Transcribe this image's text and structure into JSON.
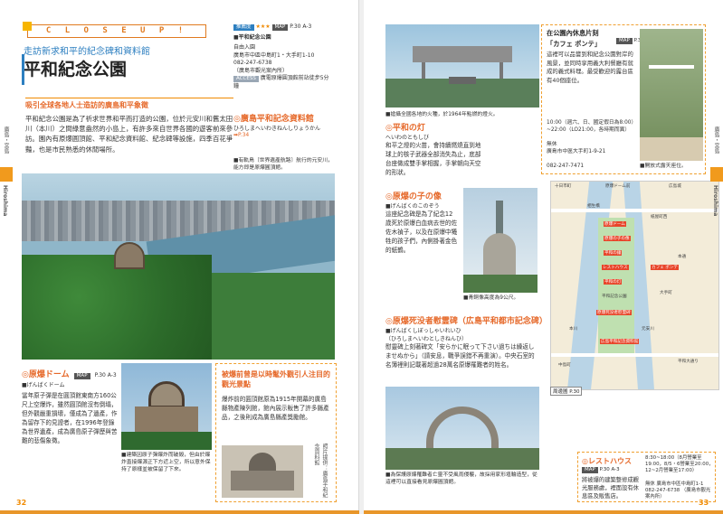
{
  "left": {
    "closeup": "C L O S E   U P !",
    "subtitle": "走訪新求和平的紀念碑和資料館",
    "title": "平和紀念公園",
    "info": {
      "rating_label": "推薦度",
      "stars": "★★★",
      "map_label": "MAP",
      "map_ref": "P.30 A-3",
      "name": "■平和紀念公園",
      "free": "自由入園",
      "address": "廣島市中區中島町1・大手町1-10",
      "tel": "082-247-6738",
      "tel_note": "（廣島市觀光案內所）",
      "access_label": "ACCESS",
      "access": "廣電原爆圓頂館前站徒步5分鐘"
    },
    "lead": "吸引全球各地人士造訪的廣島和平象徵",
    "intro": "平和紀念公園是為了祈求世界和平而打造的公園，位於元安川和舊太田川（本川）之間綠意盎然的小島上，有許多來自世界各國的遊客前來參訪。園內有原爆圓頂館、平和紀念資料館、紀念碑等設施，四季百花爭豔，也是市民熟悉的休閒場所。",
    "museum": {
      "title": "◎廣島平和記念資料館",
      "ruby": "ひろしまへいわきねんしりょうかん",
      "map": "➡P.34"
    },
    "photo_note": "■有軌鳥〔世界遺產航路〕航行的元安川，能方即是原爆圓頂館。",
    "dome": {
      "title": "◎原爆ドーム",
      "ruby": "■げんばくドーム",
      "map_label": "MAP",
      "map_ref": "P.30 A-3",
      "body": "當年原子彈是在圓頂館東南方160公尺上空爆炸，雖然圓頂館沒有倒塌，但外觀嚴重損壞，僅成為了遺產，作為留存下的見證者，在1996年登錄為世界遺產，成為廣島原子彈歷與苦難的悲傷象徵。",
      "caption": "■建築因原子彈爆炸而破毀，但由於爆炸直接爆源正下方近上空，所以意外保持了原樣並被保留了下來。"
    },
    "column": {
      "title": "被爆前曾是以時髦外觀引人注目的觀光景點",
      "body": "爆炸前的圓頂館原為1915年開幕的廣島縣物產陳列館，館內展示販售了許多縣產品，之後則成為廣島縣產獎勵館。",
      "vertical": "照片提供：廣島平和紀念資料館"
    },
    "page": "32",
    "side": "廣島・宮島",
    "side_en": "Hiroshima"
  },
  "right": {
    "photo1_cap": "■搶攝全國各地的火種，於1964年點燃的燈火。",
    "flame": {
      "title": "◎平和の灯",
      "ruby": "へいわのともしび",
      "body": "和平之燈的火苗，會持續燃燒直到地球上的核子武器全部消失為止，底部台座做成雙手掌相握，手掌朝向天空的形狀。"
    },
    "statue": {
      "title": "◎原爆の子の像",
      "ruby": "■げんばくのこのぞう",
      "body": "這座紀念碑是為了紀念12歲死於原爆白血病去世的佐佐木禎子，以及在原爆中犧牲的孩子們，內側掛著金色的紙鶴。",
      "caption": "■青銅像高度為9公尺。"
    },
    "cenotaph": {
      "title": "◎原爆死没者慰霊碑（広島平和都市記念碑）",
      "ruby": "■げんばくしぼっしゃいれいひ",
      "ruby2": "（ひろしまへいわとしきねんひ）",
      "body": "慰靈碑上刻著碑文「安らかに眠って下さい過ちは繰返しませぬから」（請安息，戰爭誤錯不再重演）。中央石室的名簿裡則記載著超過28萬名原爆罹難者的姓名。",
      "caption": "■為保護原爆罹難者亡靈不受風雨侵襲，故採用家形埴輪造型，從這裡可以直接看見原爆圓頂館。"
    },
    "cafe": {
      "title": "在公園內休息片刻",
      "name": "「カフェ ポンテ」",
      "map_label": "MAP",
      "map_ref": "P.30 A-3",
      "body": "這裡可以品嘗到和紀念公園對岸的風景，並同時享用義大利餐廳有就成的義式料理。最受歡迎的露台區有40個座位。",
      "hours": "10:00（週六、日、國定假日為8:00）~22:00（LO21:00，各時期而異）",
      "closed": "無休",
      "address": "廣島市中區大手町1-9-21",
      "tel": "082-247-7471",
      "photo_cap": "■開放式露天座位。"
    },
    "map": {
      "labels": [
        "十日市町",
        "原爆ドーム前",
        "紙屋町西",
        "広島城",
        "相生橋",
        "本通",
        "原爆ドーム",
        "原爆の子の像",
        "平和の鐘",
        "平和の灯",
        "レストハウス",
        "カフェ ポンテ",
        "平和記念公園",
        "原爆死没者慰霊碑",
        "広島平和記念資料館",
        "平和大通り",
        "元安川",
        "本川",
        "中島町",
        "大手町"
      ],
      "ref": "周邊圖 P.30"
    },
    "rest": {
      "title": "◎レストハウス",
      "map_label": "MAP",
      "map_ref": "P.30 A-3",
      "body": "將被爆的建築整修成觀光服務處，裡面設有休息區及販售店。",
      "hours": "8:30~18:00（8月營業至19:00，8/5・6營業至20:00，12~2月營業至17:00）",
      "closed": "無休",
      "address": "廣島市中區中島町1-1",
      "tel": "082-247-6738",
      "tel_note": "（廣島市觀光案內所）"
    },
    "page": "33",
    "side": "廣島・宮島",
    "side_en": "Hiroshima"
  }
}
